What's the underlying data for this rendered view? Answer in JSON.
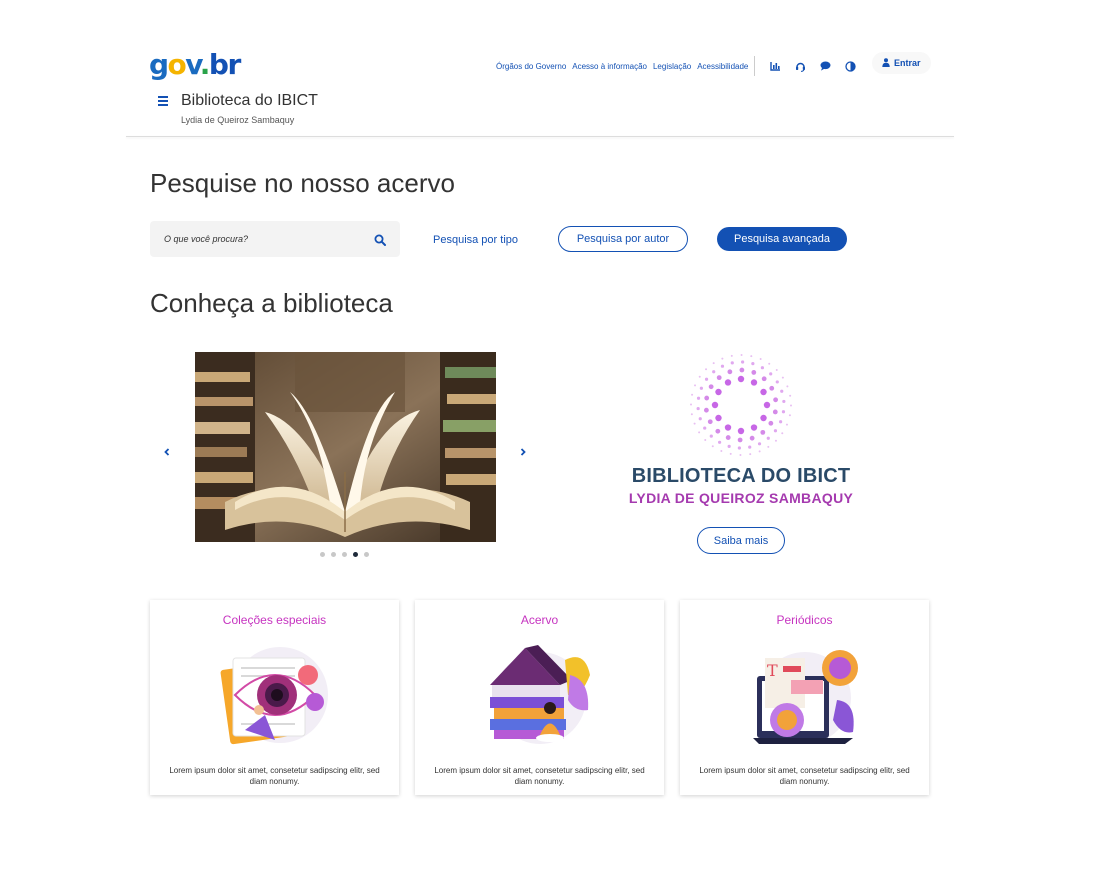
{
  "header": {
    "logo": {
      "g": "g",
      "o": "o",
      "v": "v",
      "dot": ".",
      "br": "br"
    },
    "links": [
      "Órgãos do Governo",
      "Acesso à informação",
      "Legislação",
      "Acessibilidade"
    ],
    "icons": [
      "chart-icon",
      "headset-icon",
      "chat-icon",
      "contrast-icon"
    ],
    "login_label": "Entrar",
    "site_title": "Biblioteca do IBICT",
    "site_subtitle": "Lydia de Queiroz Sambaquy"
  },
  "search": {
    "heading": "Pesquise no nosso acervo",
    "placeholder": "O que você procura?",
    "by_type": "Pesquisa por tipo",
    "by_author": "Pesquisa por autor",
    "advanced": "Pesquisa avançada"
  },
  "about": {
    "heading": "Conheça a biblioteca",
    "carousel": {
      "slide_count": 5,
      "active_index": 3
    },
    "library_name": "BIBLIOTECA DO IBICT",
    "library_subname": "LYDIA DE QUEIROZ SAMBAQUY",
    "more_label": "Saiba mais"
  },
  "cards": [
    {
      "title": "Coleções especiais",
      "text": "Lorem ipsum dolor sit amet, consetetur sadipscing elitr, sed diam nonumy."
    },
    {
      "title": "Acervo",
      "text": "Lorem ipsum dolor sit amet, consetetur sadipscing elitr, sed diam nonumy."
    },
    {
      "title": "Periódicos",
      "text": "Lorem ipsum dolor sit amet, consetetur sadipscing elitr, sed diam nonumy."
    }
  ],
  "colors": {
    "primary": "#1351b4",
    "accent": "#c634c0",
    "library_navy": "#2a4a68",
    "library_purple": "#a53aaf"
  }
}
